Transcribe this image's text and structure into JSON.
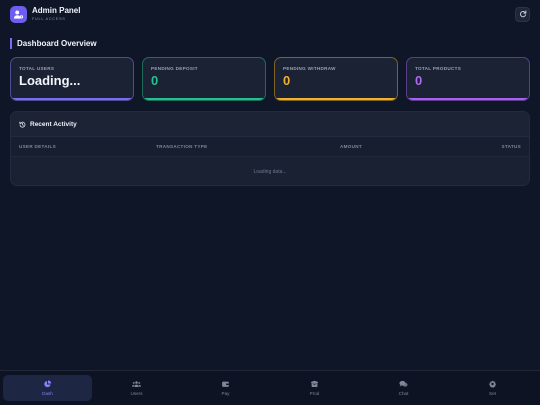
{
  "header": {
    "title": "Admin Panel",
    "subtitle": "FULL ACCESS",
    "app_icon": "user-gear-icon",
    "refresh_icon": "refresh-icon"
  },
  "dashboard": {
    "title": "Dashboard Overview"
  },
  "stats": [
    {
      "label": "TOTAL USERS",
      "value": "Loading...",
      "accent": "#7c6cf5"
    },
    {
      "label": "PENDING DEPOSIT",
      "value": "0",
      "accent": "#22c38f"
    },
    {
      "label": "PENDING WITHDRAW",
      "value": "0",
      "accent": "#f1b02d"
    },
    {
      "label": "TOTAL PRODUCTS",
      "value": "0",
      "accent": "#a95ff0"
    }
  ],
  "activity": {
    "title": "Recent Activity",
    "icon": "history-icon",
    "columns": [
      "USER DETAILS",
      "TRANSACTION TYPE",
      "AMOUNT",
      "STATUS"
    ],
    "empty_text": "Loading data..."
  },
  "nav": [
    {
      "label": "Dash",
      "icon": "chart-pie-icon",
      "active": true
    },
    {
      "label": "Users",
      "icon": "users-icon",
      "active": false
    },
    {
      "label": "Pay",
      "icon": "wallet-icon",
      "active": false
    },
    {
      "label": "Prod",
      "icon": "box-icon",
      "active": false
    },
    {
      "label": "Chat",
      "icon": "chat-icon",
      "active": false
    },
    {
      "label": "Set",
      "icon": "gear-icon",
      "active": false
    }
  ]
}
